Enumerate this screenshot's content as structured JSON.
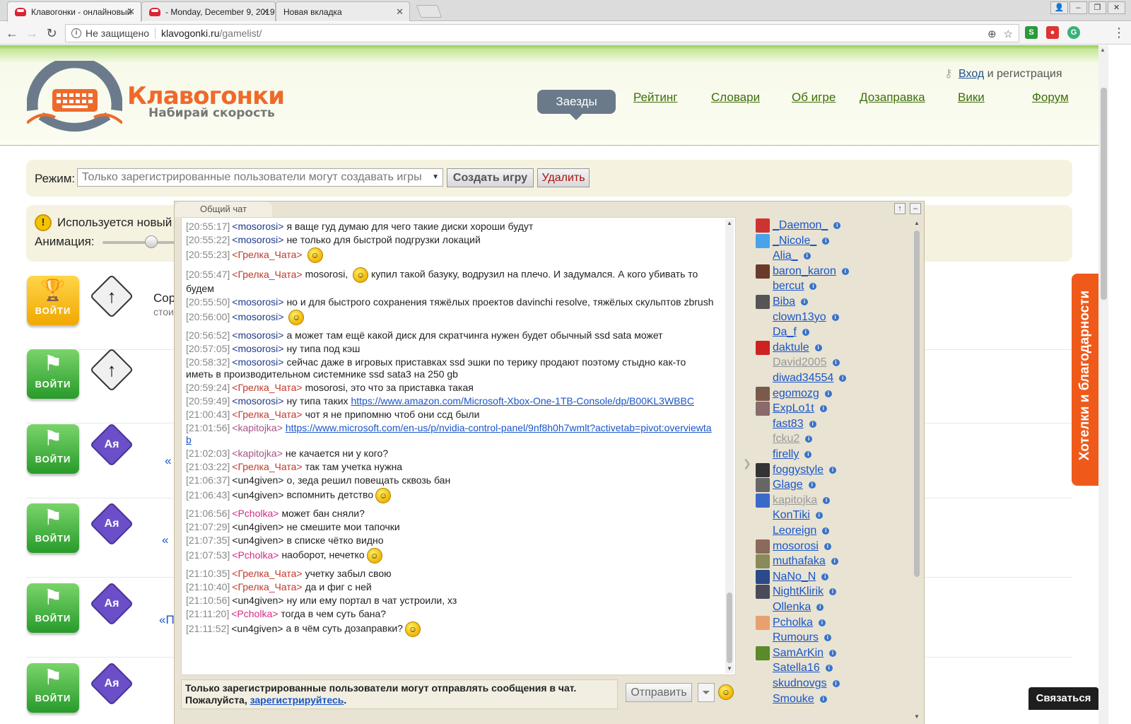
{
  "browser": {
    "tabs": [
      {
        "title": "Клавогонки - онлайновый"
      },
      {
        "title": "- Monday, December 9, 2019"
      },
      {
        "title": "Новая вкладка"
      }
    ],
    "address": {
      "security": "Не защищено",
      "host": "klavogonki.ru",
      "path": "/gamelist/"
    }
  },
  "header": {
    "logo_title": "Клавогонки",
    "logo_subtitle": "Набирай скорость",
    "login_link": "Вход",
    "login_rest": " и регистрация",
    "nav": [
      "Заезды",
      "Рейтинг",
      "Словари",
      "Об игре",
      "Дозаправка",
      "Вики",
      "Форум"
    ]
  },
  "mode": {
    "label": "Режим:",
    "select_value": "Только зарегистрированные пользователи могут создавать игры",
    "create_btn": "Создать игру",
    "delete_btn": "Удалить"
  },
  "notice": {
    "text": "Используется новый с",
    "animation_label": "Анимация:"
  },
  "rows": [
    {
      "enter": "ВОЙТИ",
      "text": "Сор",
      "sub": "стои"
    },
    {
      "enter": "ВОЙТИ",
      "text": "",
      "sub": ""
    },
    {
      "enter": "ВОЙТИ",
      "text": "«",
      "sub": ""
    },
    {
      "enter": "ВОЙТИ",
      "text": "«",
      "sub": ""
    },
    {
      "enter": "ВОЙТИ",
      "text": "«П",
      "sub": ""
    },
    {
      "enter": "ВОЙТИ",
      "text": "",
      "sub": ""
    }
  ],
  "chat": {
    "tab": "Общий чат",
    "messages": [
      {
        "ts": "[20:55:17]",
        "nick": "<mosorosi>",
        "c": "blue",
        "text": "я ваще гуд думаю для чего такие диски хороши будут"
      },
      {
        "ts": "[20:55:22]",
        "nick": "<mosorosi>",
        "c": "blue",
        "text": "не только для быстрой подгрузки локаций"
      },
      {
        "ts": "[20:55:23]",
        "nick": "<Грелка_Чата>",
        "c": "red",
        "text": "",
        "smile": true
      },
      {
        "ts": "[20:55:47]",
        "nick": "<Грелка_Чата>",
        "c": "red",
        "text": "mosorosi, ",
        "smile_mid": true,
        "text2": " купил такой базуку, водрузил на плечо. И задумался. А кого убивать то будем"
      },
      {
        "ts": "[20:55:50]",
        "nick": "<mosorosi>",
        "c": "blue",
        "text": "но и для быстрого сохранения тяжёлых проектов davinchi resolve, тяжёлых скульптов zbrush"
      },
      {
        "ts": "[20:56:00]",
        "nick": "<mosorosi>",
        "c": "blue",
        "text": "",
        "smile": true
      },
      {
        "ts": "[20:56:52]",
        "nick": "<mosorosi>",
        "c": "blue",
        "text": "а может там ещё какой диск для скратчинга нужен будет обычный ssd sata может"
      },
      {
        "ts": "[20:57:05]",
        "nick": "<mosorosi>",
        "c": "blue",
        "text": "ну типа под кэш"
      },
      {
        "ts": "[20:58:32]",
        "nick": "<mosorosi>",
        "c": "blue",
        "text": "сейчас даже в игровых приставках ssd эшки по терику продают поэтому стыдно как-то иметь в производительном системнике ssd sata3 на 250 gb"
      },
      {
        "ts": "[20:59:24]",
        "nick": "<Грелка_Чата>",
        "c": "red",
        "text": "mosorosi, это что за приставка такая"
      },
      {
        "ts": "[20:59:49]",
        "nick": "<mosorosi>",
        "c": "blue",
        "text": "ну типа таких ",
        "link": "https://www.amazon.com/Microsoft-Xbox-One-1TB-Console/dp/B00KL3WBBC"
      },
      {
        "ts": "[21:00:43]",
        "nick": "<Грелка_Чата>",
        "c": "red",
        "text": "чот я не припомню чтоб они ссд были"
      },
      {
        "ts": "[21:01:56]",
        "nick": "<kapitojka>",
        "c": "mauve",
        "text": "",
        "link": "https://www.microsoft.com/en-us/p/nvidia-control-panel/9nf8h0h7wmlt?activetab=pivot:overviewtab"
      },
      {
        "ts": "[21:02:03]",
        "nick": "<kapitojka>",
        "c": "mauve",
        "text": "не качается ни у кого?"
      },
      {
        "ts": "[21:03:22]",
        "nick": "<Грелка_Чата>",
        "c": "red",
        "text": "так там учетка нужна"
      },
      {
        "ts": "[21:06:37]",
        "nick": "<un4given>",
        "c": "black",
        "text": "о, зеда решил повещать сквозь бан"
      },
      {
        "ts": "[21:06:43]",
        "nick": "<un4given>",
        "c": "black",
        "text": "вспомнить детство",
        "smile": true
      },
      {
        "ts": "[21:06:56]",
        "nick": "<Pcholka>",
        "c": "pink",
        "text": "может бан сняли?"
      },
      {
        "ts": "[21:07:29]",
        "nick": "<un4given>",
        "c": "black",
        "text": "не смешите мои тапочки"
      },
      {
        "ts": "[21:07:35]",
        "nick": "<un4given>",
        "c": "black",
        "text": "в списке чётко видно"
      },
      {
        "ts": "[21:07:53]",
        "nick": "<Pcholka>",
        "c": "pink",
        "text": "наоборот, нечетко",
        "smile": true
      },
      {
        "ts": "[21:10:35]",
        "nick": "<Грелка_Чата>",
        "c": "red",
        "text": "учетку забыл свою"
      },
      {
        "ts": "[21:10:40]",
        "nick": "<Грелка_Чата>",
        "c": "red",
        "text": "да и фиг с ней"
      },
      {
        "ts": "[21:10:56]",
        "nick": "<un4given>",
        "c": "black",
        "text": "ну или ему портал в чат устроили, хз"
      },
      {
        "ts": "[21:11:20]",
        "nick": "<Pcholka>",
        "c": "pink",
        "text": "тогда в чем суть бана?"
      },
      {
        "ts": "[21:11:52]",
        "nick": "<un4given>",
        "c": "black",
        "text": "а в чём суть дозаправки?",
        "smile": true
      }
    ],
    "reg_notice_line1": "Только зарегистрированные пользователи могут отправлять сообщения в чат.",
    "reg_notice_pre": "Пожалуйста, ",
    "reg_notice_link": "зарегистрируйтесь",
    "reg_notice_post": ".",
    "send_btn": "Отправить",
    "users": [
      {
        "name": "_Daemon_",
        "av": "#c33"
      },
      {
        "name": "_Nicole_",
        "av": "#4aa3e8"
      },
      {
        "name": "Alia_",
        "av": ""
      },
      {
        "name": "baron_karon",
        "av": "#6a3a2a"
      },
      {
        "name": "bercut",
        "av": ""
      },
      {
        "name": "Biba",
        "av": "#555"
      },
      {
        "name": "clown13yo",
        "av": ""
      },
      {
        "name": "Da_f",
        "av": ""
      },
      {
        "name": "daktule",
        "av": "#c22"
      },
      {
        "name": "David2005",
        "av": "",
        "gray": true
      },
      {
        "name": "diwad34554",
        "av": ""
      },
      {
        "name": "egomozg",
        "av": "#7a5a4a"
      },
      {
        "name": "ExpLo1t",
        "av": "#8a6a6a"
      },
      {
        "name": "fast83",
        "av": ""
      },
      {
        "name": "fcku2",
        "av": "",
        "gray": true
      },
      {
        "name": "firelly",
        "av": ""
      },
      {
        "name": "foggystyle",
        "av": "#333"
      },
      {
        "name": "Glage",
        "av": "#666"
      },
      {
        "name": "kapitojka",
        "av": "#3a6ac8",
        "gray": true
      },
      {
        "name": "KonTiki",
        "av": ""
      },
      {
        "name": "Leoreign",
        "av": ""
      },
      {
        "name": "mosorosi",
        "av": "#8a6a5a"
      },
      {
        "name": "muthafaka",
        "av": "#8a8a5a"
      },
      {
        "name": "NaNo_N",
        "av": "#2a4a8a"
      },
      {
        "name": "NightKlirik",
        "av": "#4a4a5a"
      },
      {
        "name": "Ollenka",
        "av": ""
      },
      {
        "name": "Pcholka",
        "av": "#e8a070"
      },
      {
        "name": "Rumours",
        "av": ""
      },
      {
        "name": "SamArKin",
        "av": "#5a8a2a"
      },
      {
        "name": "Satella16",
        "av": ""
      },
      {
        "name": "skudnovgs",
        "av": ""
      },
      {
        "name": "Smouke",
        "av": ""
      }
    ]
  },
  "side": {
    "wishes": "Хотелки и благодарности",
    "contact": "Связаться"
  },
  "colors": {
    "accent_orange": "#ef5a1a",
    "nav_green": "#3e6f08",
    "link_blue": "#1a56c8"
  }
}
